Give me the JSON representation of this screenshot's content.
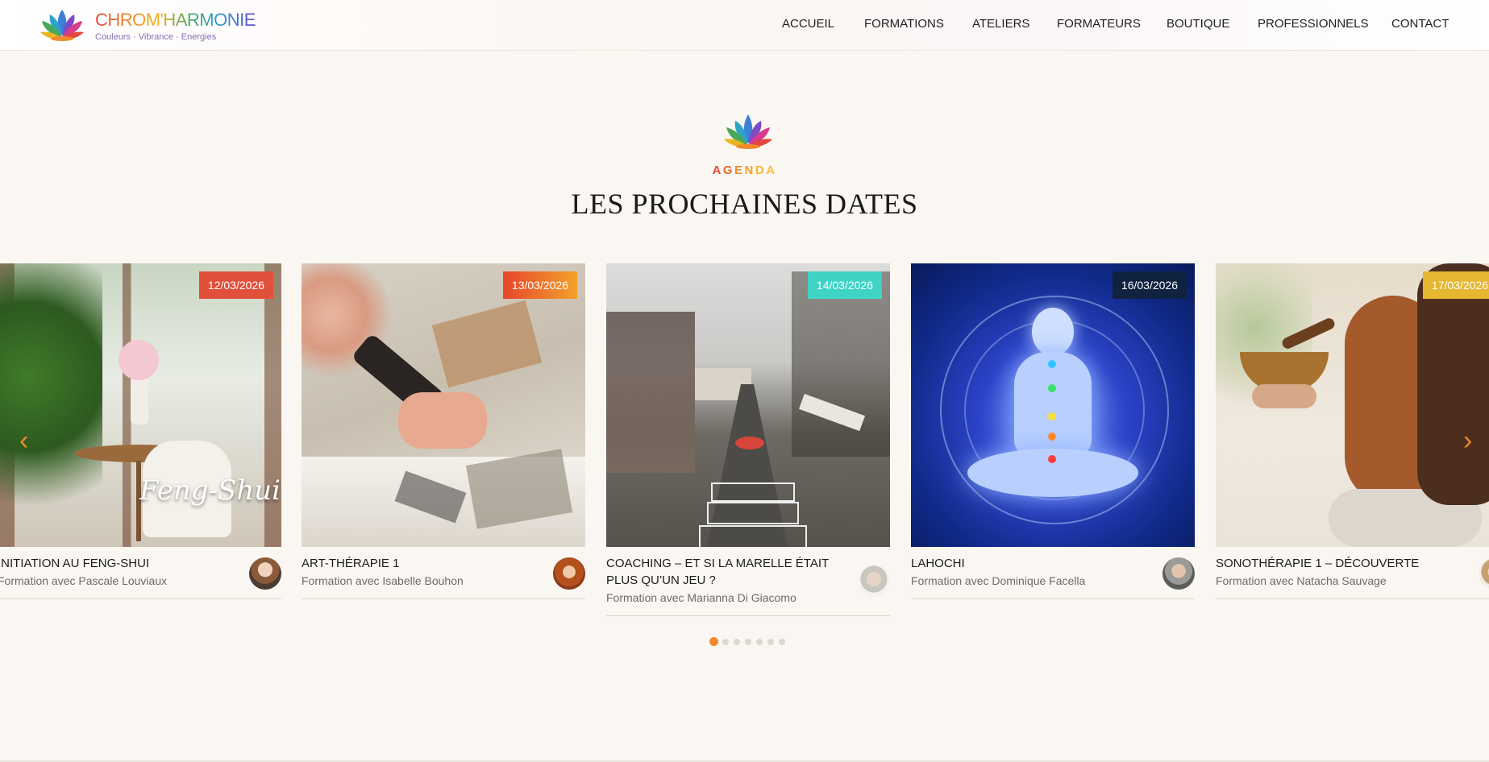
{
  "site": {
    "name": "CHROM'HARMONIE",
    "tagline": "Couleurs · Vibrance · Energies"
  },
  "nav": [
    {
      "label": "ACCUEIL"
    },
    {
      "label": "FORMATIONS"
    },
    {
      "label": "ATELIERS"
    },
    {
      "label": "FORMATEURS"
    },
    {
      "label": "BOUTIQUE"
    },
    {
      "label": "PROFESSIONNELS"
    },
    {
      "label": "CONTACT"
    }
  ],
  "agenda": {
    "eyebrow": [
      "A",
      "G",
      "E",
      "N",
      "D",
      "A"
    ],
    "title": "LES PROCHAINES DATES"
  },
  "cards": [
    {
      "date": "12/03/2026",
      "badge_color": "#e0503b",
      "title": "INITIATION AU FENG-SHUI",
      "subtitle": "Formation avec Pascale Louviaux",
      "image_text": "Feng-Shui"
    },
    {
      "date": "13/03/2026",
      "badge_color": "#f0702a",
      "title": "ART-THÉRAPIE 1",
      "subtitle": "Formation avec Isabelle Bouhon"
    },
    {
      "date": "14/03/2026",
      "badge_color": "#3fd3c4",
      "title": "COACHING – ET SI LA MARELLE ÉTAIT PLUS QU’UN JEU ?",
      "subtitle": "Formation avec Marianna Di Giacomo"
    },
    {
      "date": "16/03/2026",
      "badge_color": "#0f2340",
      "title": "LAHOCHI",
      "subtitle": "Formation avec Dominique Facella"
    },
    {
      "date": "17/03/2026",
      "badge_color": "#e6b730",
      "title": "SONOTHÉRAPIE 1 – DÉCOUVERTE",
      "subtitle": "Formation avec Natacha Sauvage"
    }
  ],
  "carousel": {
    "prev_icon": "chevron-left-icon",
    "next_icon": "chevron-right-icon",
    "prev_glyph": "‹",
    "next_glyph": "›",
    "dots": 7,
    "active_dot": 0
  },
  "colors": {
    "accent": "#ef8a2a",
    "background": "#faf7f2"
  }
}
